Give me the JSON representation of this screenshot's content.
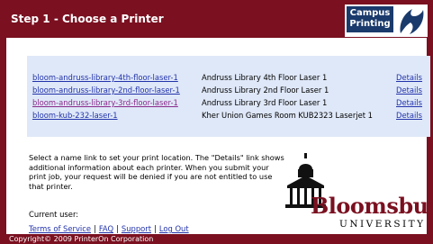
{
  "header": {
    "title": "Step 1 - Choose a Printer",
    "logo_text": "Campus Printing"
  },
  "printers": [
    {
      "name": "bloom-andruss-library-4th-floor-laser-1",
      "description": "Andruss Library 4th Floor Laser 1",
      "details": "Details",
      "visited": false
    },
    {
      "name": "bloom-andruss-library-2nd-floor-laser-1",
      "description": "Andruss Library 2nd Floor Laser 1",
      "details": "Details",
      "visited": false
    },
    {
      "name": "bloom-andruss-library-3rd-floor-laser-1",
      "description": "Andruss Library 3rd Floor Laser 1",
      "details": "Details",
      "visited": true
    },
    {
      "name": "bloom-kub-232-laser-1",
      "description": "Kher Union Games Room KUB2323 Laserjet 1",
      "details": "Details",
      "visited": false
    }
  ],
  "instructions": "Select a name link to set your print location. The \"Details\" link shows additional information about each printer. When you submit your print job, your request will be denied if you are not entitled to use that printer.",
  "current_user_label": "Current user:",
  "footer_links": {
    "terms": "Terms of Service",
    "faq": "FAQ",
    "support": "Support",
    "logout": "Log Out",
    "separator": "|"
  },
  "copyright": "Copyright© 2009 PrinterOn Corporation",
  "brand": {
    "name": "Bloomsburg",
    "subtitle": "UNIVERSITY"
  },
  "colors": {
    "maroon": "#7a1020",
    "navy": "#1a3a6c",
    "panel": "#dfe8f8",
    "link": "#2233aa",
    "visited": "#8a2a8a"
  }
}
